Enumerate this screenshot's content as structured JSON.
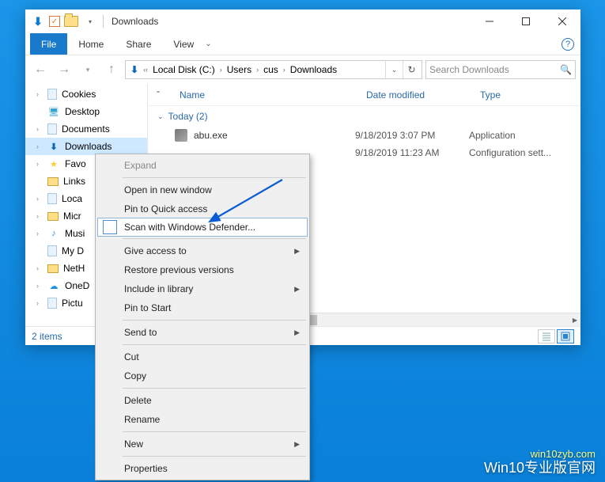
{
  "window": {
    "title": "Downloads"
  },
  "ribbon": {
    "file": "File",
    "tabs": [
      "Home",
      "Share",
      "View"
    ]
  },
  "breadcrumb": {
    "parts": [
      "Local Disk (C:)",
      "Users",
      "cus",
      "Downloads"
    ]
  },
  "search": {
    "placeholder": "Search Downloads"
  },
  "nav": {
    "items": [
      {
        "label": "Cookies",
        "icon": "file",
        "expandable": true
      },
      {
        "label": "Desktop",
        "icon": "desktop",
        "expandable": false
      },
      {
        "label": "Documents",
        "icon": "file",
        "expandable": true
      },
      {
        "label": "Downloads",
        "icon": "download",
        "expandable": true,
        "selected": true
      },
      {
        "label": "Favo",
        "icon": "star",
        "expandable": true
      },
      {
        "label": "Links",
        "icon": "folder",
        "expandable": false
      },
      {
        "label": "Loca",
        "icon": "file",
        "expandable": true
      },
      {
        "label": "Micr",
        "icon": "folder",
        "expandable": true
      },
      {
        "label": "Musi",
        "icon": "music",
        "expandable": true
      },
      {
        "label": "My D",
        "icon": "file",
        "expandable": false
      },
      {
        "label": "NetH",
        "icon": "folder",
        "expandable": true
      },
      {
        "label": "OneD",
        "icon": "onedrive",
        "expandable": true
      },
      {
        "label": "Pictu",
        "icon": "file",
        "expandable": true
      }
    ]
  },
  "columns": {
    "name": "Name",
    "date": "Date modified",
    "type": "Type"
  },
  "group": {
    "label": "Today (2)"
  },
  "files": [
    {
      "name": "abu.exe",
      "date": "9/18/2019 3:07 PM",
      "type": "Application",
      "icon": "exe"
    },
    {
      "name": "",
      "date": "9/18/2019 11:23 AM",
      "type": "Configuration sett...",
      "icon": ""
    }
  ],
  "status": {
    "count": "2 items"
  },
  "context_menu": {
    "items": [
      {
        "label": "Expand",
        "kind": "disabled"
      },
      {
        "kind": "sep"
      },
      {
        "label": "Open in new window"
      },
      {
        "label": "Pin to Quick access"
      },
      {
        "label": "Scan with Windows Defender...",
        "kind": "hover",
        "icon": "defender"
      },
      {
        "kind": "sep"
      },
      {
        "label": "Give access to",
        "submenu": true
      },
      {
        "label": "Restore previous versions"
      },
      {
        "label": "Include in library",
        "submenu": true
      },
      {
        "label": "Pin to Start"
      },
      {
        "kind": "sep"
      },
      {
        "label": "Send to",
        "submenu": true
      },
      {
        "kind": "sep"
      },
      {
        "label": "Cut"
      },
      {
        "label": "Copy"
      },
      {
        "kind": "sep"
      },
      {
        "label": "Delete"
      },
      {
        "label": "Rename"
      },
      {
        "kind": "sep"
      },
      {
        "label": "New",
        "submenu": true
      },
      {
        "kind": "sep"
      },
      {
        "label": "Properties"
      }
    ]
  },
  "watermark": {
    "line1": "win10zyb.com",
    "line2": "Win10专业版官网"
  }
}
